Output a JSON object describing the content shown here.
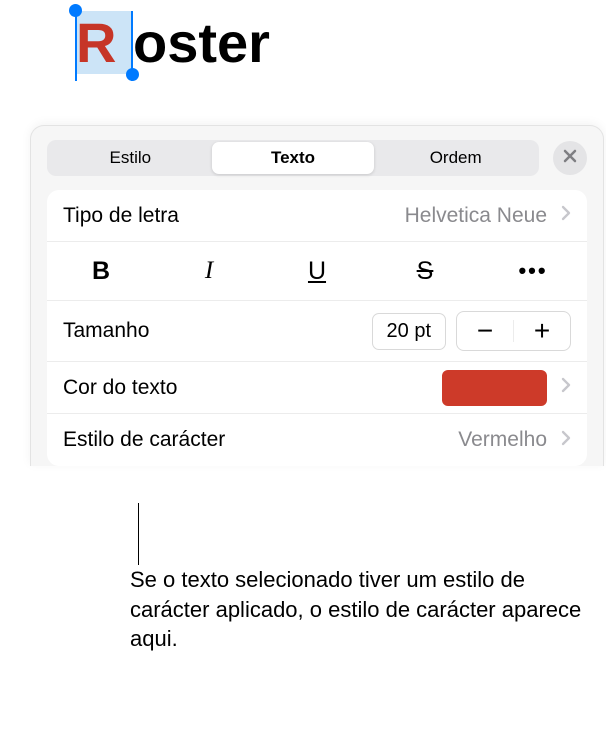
{
  "canvas": {
    "selected_char": "R",
    "remaining_text": "oster"
  },
  "tabs": {
    "style": "Estilo",
    "text": "Texto",
    "order": "Ordem"
  },
  "font": {
    "label": "Tipo de letra",
    "value": "Helvetica Neue"
  },
  "style_buttons": {
    "bold": "B",
    "italic": "I",
    "underline": "U",
    "strike": "S",
    "more": "•••"
  },
  "size": {
    "label": "Tamanho",
    "value": "20 pt",
    "minus": "−",
    "plus": "+"
  },
  "text_color": {
    "label": "Cor do texto",
    "color": "#CD3A29"
  },
  "char_style": {
    "label": "Estilo de carácter",
    "value": "Vermelho"
  },
  "callout": "Se o texto selecionado tiver um estilo de carácter aplicado, o estilo de carácter aparece aqui."
}
